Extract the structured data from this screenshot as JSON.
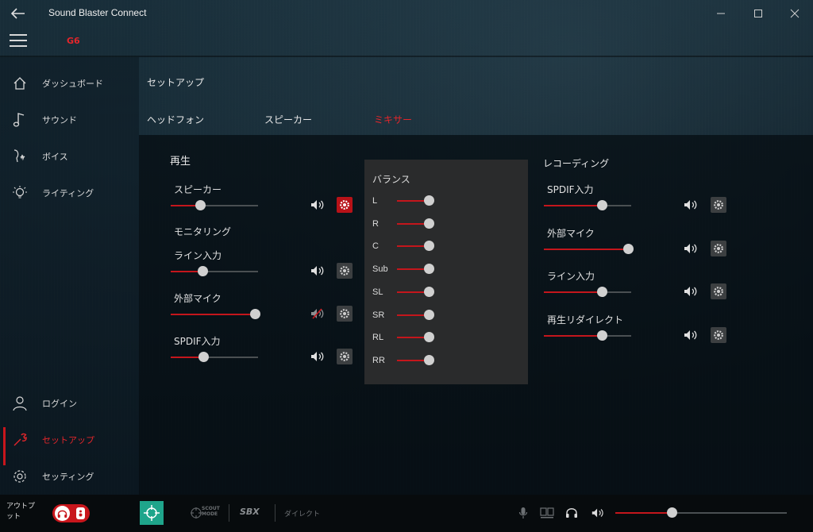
{
  "app": {
    "title": "Sound Blaster Connect",
    "device": "G6"
  },
  "colors": {
    "accent": "#e3262b",
    "slider_fill": "#c4161c",
    "scout_tile": "#1fa58b"
  },
  "sidebar": {
    "items": [
      {
        "label": "ダッシュボード",
        "icon": "home-icon"
      },
      {
        "label": "サウンド",
        "icon": "music-note-icon"
      },
      {
        "label": "ボイス",
        "icon": "voice-icon"
      },
      {
        "label": "ライティング",
        "icon": "lightbulb-icon"
      }
    ],
    "bottom_items": [
      {
        "label": "ログイン",
        "icon": "user-icon"
      },
      {
        "label": "セットアップ",
        "icon": "wrench-icon",
        "active": true
      },
      {
        "label": "セッティング",
        "icon": "gear-icon"
      }
    ]
  },
  "main": {
    "page_title": "セットアップ",
    "tabs": [
      {
        "label": "ヘッドフォン",
        "active": false
      },
      {
        "label": "スピーカー",
        "active": false
      },
      {
        "label": "ミキサー",
        "active": true
      }
    ]
  },
  "playback": {
    "title": "再生",
    "monitoring_title": "モニタリング",
    "channels": [
      {
        "label": "スピーカー",
        "level": 0.34,
        "muted": false,
        "settings_active": true
      },
      {
        "label": "ライン入力",
        "level": 0.36,
        "muted": false,
        "settings_active": false
      },
      {
        "label": "外部マイク",
        "level": 0.96,
        "muted": true,
        "settings_active": false
      },
      {
        "label": "SPDIF入力",
        "level": 0.37,
        "muted": false,
        "settings_active": false
      }
    ]
  },
  "balance": {
    "title": "バランス",
    "channels": [
      {
        "label": "L",
        "level": 1.0
      },
      {
        "label": "R",
        "level": 1.0
      },
      {
        "label": "C",
        "level": 1.0
      },
      {
        "label": "Sub",
        "level": 1.0
      },
      {
        "label": "SL",
        "level": 1.0
      },
      {
        "label": "SR",
        "level": 1.0
      },
      {
        "label": "RL",
        "level": 1.0
      },
      {
        "label": "RR",
        "level": 1.0
      }
    ]
  },
  "recording": {
    "title": "レコーディング",
    "channels": [
      {
        "label": "SPDIF入力",
        "level": 0.66
      },
      {
        "label": "外部マイク",
        "level": 0.96
      },
      {
        "label": "ライン入力",
        "level": 0.66
      },
      {
        "label": "再生リダイレクト",
        "level": 0.66
      }
    ]
  },
  "bottombar": {
    "output_label": "アウトプット",
    "scout_label": "SCOUT MODE",
    "sbx_label": "SBX",
    "direct_label": "ダイレクト",
    "master_volume": 0.33
  }
}
